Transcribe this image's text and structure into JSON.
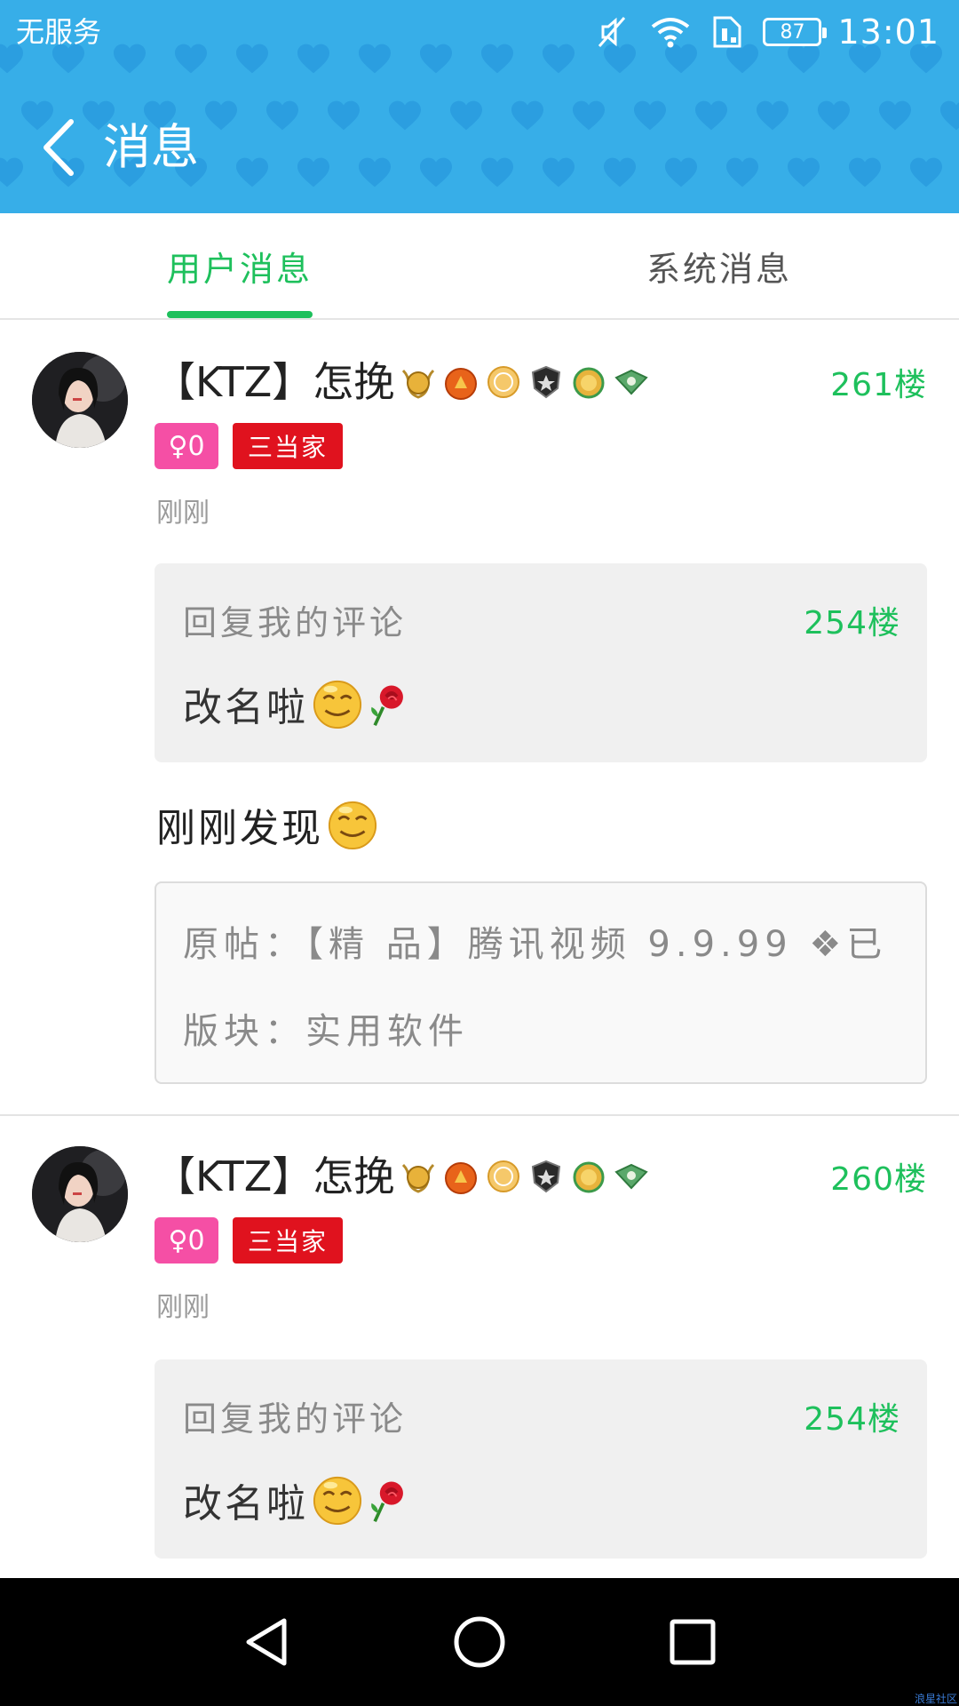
{
  "status_bar": {
    "carrier": "无服务",
    "battery": "87",
    "time": "13:01",
    "icons": [
      "mute-icon",
      "wifi-icon",
      "sim-icon",
      "battery-icon"
    ]
  },
  "header": {
    "title": "消息",
    "back_icon": "chevron-left-icon",
    "background_color": "#37aee8"
  },
  "tabs": [
    {
      "label": "用户消息",
      "active": true
    },
    {
      "label": "系统消息",
      "active": false
    }
  ],
  "colors": {
    "accent": "#1ec05c",
    "gender_badge": "#f54fa5",
    "title_badge": "#e0121e"
  },
  "messages": [
    {
      "username": "【KTZ】怎挽",
      "floor": "261楼",
      "gender_badge": "♀0",
      "title_badge": "三当家",
      "time": "刚刚",
      "reply": {
        "label": "回复我的评论",
        "floor": "254楼",
        "text": "改名啦"
      },
      "content": "刚刚发现",
      "original": {
        "post": "原帖：【精 品】腾讯视频 9.9.99 ❖已",
        "section": "版块：实用软件"
      }
    },
    {
      "username": "【KTZ】怎挽",
      "floor": "260楼",
      "gender_badge": "♀0",
      "title_badge": "三当家",
      "time": "刚刚",
      "reply": {
        "label": "回复我的评论",
        "floor": "254楼",
        "text": "改名啦"
      }
    }
  ],
  "nav_bar": {
    "buttons": [
      "back-icon",
      "home-icon",
      "recents-icon"
    ]
  },
  "watermark": "浪星社区"
}
